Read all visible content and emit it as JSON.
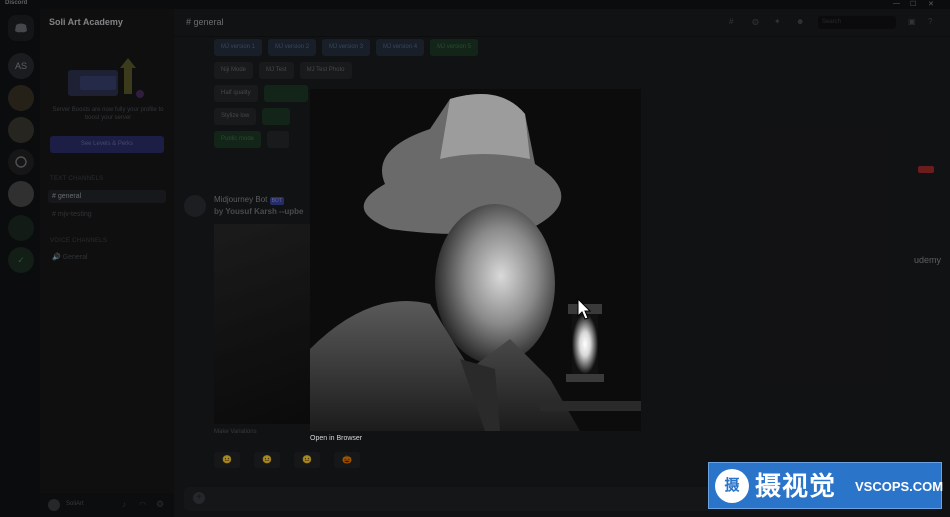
{
  "titlebar": {
    "app_name": "Discord",
    "min": "—",
    "max": "☐",
    "close": "✕"
  },
  "guilds": {
    "home_icon": "discord-logo-icon",
    "items": [
      "AS",
      "",
      "",
      "",
      "",
      "",
      "✓"
    ]
  },
  "sidebar": {
    "server_name": "Soli Art Academy",
    "promo_text": "Server Boosts are now fully your profile to boost your server",
    "promo_button": "See Levels & Perks",
    "category_text": "TEXT CHANNELS",
    "channels": [
      {
        "label": "# general"
      },
      {
        "label": "# mjv-testing"
      }
    ],
    "category_voice": "VOICE CHANNELS",
    "voice_channels": [
      {
        "label": "🔊 General"
      }
    ],
    "user_name": "SoliArt"
  },
  "header": {
    "channel": "general",
    "search_placeholder": "Search"
  },
  "buttons": {
    "row1": [
      "MJ version 1",
      "MJ version 2",
      "MJ version 3",
      "MJ version 4",
      "MJ version 5"
    ],
    "row2": [
      "Niji Mode",
      "MJ Test",
      "MJ Test Photo"
    ],
    "row3": [
      "Half quality"
    ],
    "row4": [
      "Stylize low"
    ],
    "row5": [
      "Public mode"
    ]
  },
  "message": {
    "author": "Midjourney Bot",
    "badge": "BOT",
    "text": "by Yousuf Karsh --upbe"
  },
  "variations_label": "Make Variations",
  "emojis": [
    "😐",
    "😐",
    "😐",
    "🎃"
  ],
  "viewer": {
    "open_in_browser": "Open in Browser"
  },
  "watermark": {
    "logo_char": "摄",
    "cn": "摄视觉",
    "en": "VSCOPS.COM"
  },
  "udemy": "udemy"
}
